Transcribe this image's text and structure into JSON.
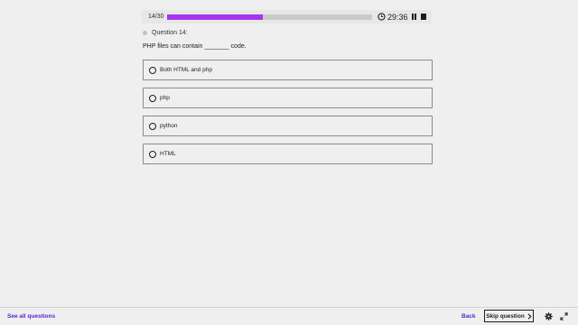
{
  "progress": {
    "count_text": "14/30",
    "current": 14,
    "total": 30,
    "fill_fraction": 0.4667,
    "fill_color": "#a435f0"
  },
  "timer": {
    "time_text": "29:36",
    "icons": [
      "clock-icon",
      "pause-icon",
      "stop-icon"
    ]
  },
  "question": {
    "label": "Question 14:",
    "text": "PHP files can contain _______ code."
  },
  "options": [
    {
      "label": "Both HTML and php"
    },
    {
      "label": "php"
    },
    {
      "label": "python"
    },
    {
      "label": "HTML"
    }
  ],
  "footer": {
    "see_all_label": "See all questions",
    "back_label": "Back",
    "skip_label": "Skip question",
    "icons": [
      "chevron-right-icon",
      "gear-icon",
      "expand-icon"
    ],
    "link_color": "#5624d0"
  }
}
